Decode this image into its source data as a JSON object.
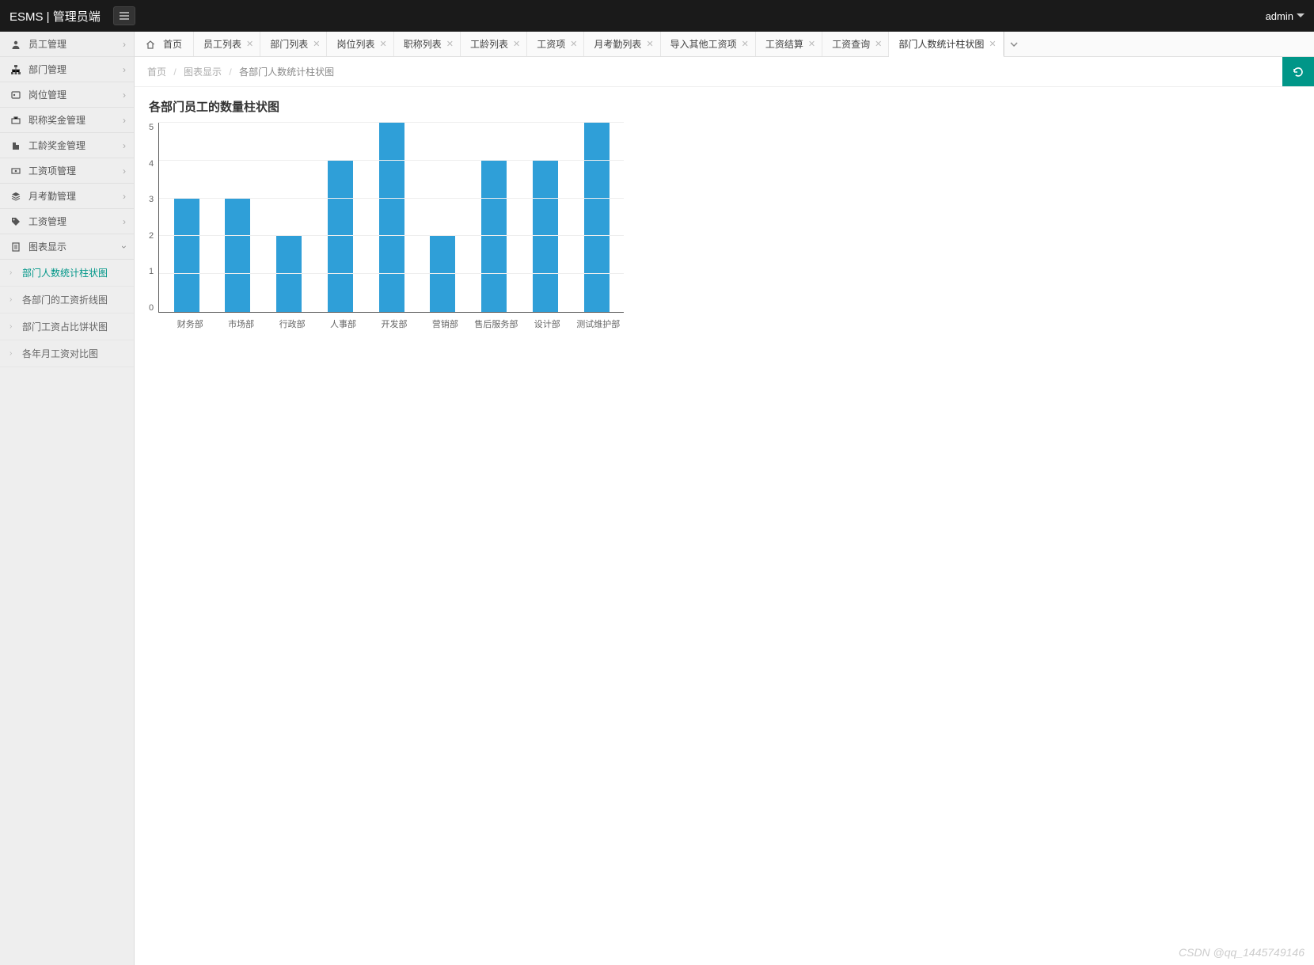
{
  "header": {
    "brand": "ESMS | 管理员端",
    "user": "admin"
  },
  "sidebar": {
    "items": [
      {
        "label": "员工管理",
        "icon": "user"
      },
      {
        "label": "部门管理",
        "icon": "sitemap"
      },
      {
        "label": "岗位管理",
        "icon": "id"
      },
      {
        "label": "职称奖金管理",
        "icon": "briefcase"
      },
      {
        "label": "工龄奖金管理",
        "icon": "building"
      },
      {
        "label": "工资项管理",
        "icon": "money"
      },
      {
        "label": "月考勤管理",
        "icon": "layers"
      },
      {
        "label": "工资管理",
        "icon": "tag"
      },
      {
        "label": "图表显示",
        "icon": "doc"
      }
    ],
    "sub": [
      {
        "label": "部门人数统计柱状图",
        "active": true
      },
      {
        "label": "各部门的工资折线图",
        "active": false
      },
      {
        "label": "部门工资占比饼状图",
        "active": false
      },
      {
        "label": "各年月工资对比图",
        "active": false
      }
    ]
  },
  "tabs": {
    "home": "首页",
    "items": [
      "员工列表",
      "部门列表",
      "岗位列表",
      "职称列表",
      "工龄列表",
      "工资项",
      "月考勤列表",
      "导入其他工资项",
      "工资结算",
      "工资查询",
      "部门人数统计柱状图"
    ],
    "active_index": 10
  },
  "breadcrumb": {
    "root": "首页",
    "mid": "图表显示",
    "current": "各部门人数统计柱状图"
  },
  "chart_title": "各部门员工的数量柱状图",
  "chart_data": {
    "type": "bar",
    "categories": [
      "财务部",
      "市场部",
      "行政部",
      "人事部",
      "开发部",
      "营销部",
      "售后服务部",
      "设计部",
      "测试维护部"
    ],
    "values": [
      3,
      3,
      2,
      4,
      5,
      2,
      4,
      4,
      5
    ],
    "ylim": [
      0,
      5
    ],
    "yticks": [
      0,
      1,
      2,
      3,
      4,
      5
    ],
    "bar_color": "#2f9fd8"
  },
  "watermark": "CSDN @qq_1445749146"
}
